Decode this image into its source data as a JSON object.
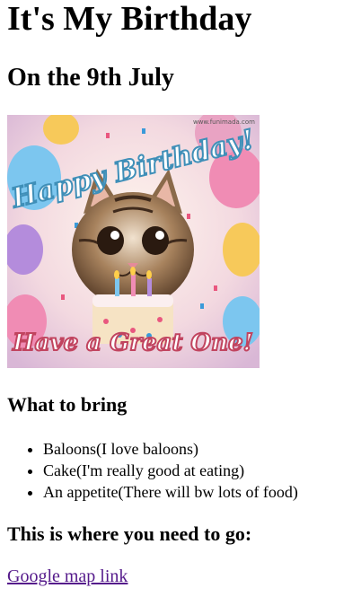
{
  "page": {
    "title": "It's My Birthday",
    "subtitle": "On the 9th July"
  },
  "image": {
    "banner_top": "Happy Birthday!",
    "banner_bottom": "Have a Great One!",
    "watermark": "www.funimada.com",
    "colors": {
      "sky": "#f3d9e0",
      "balloon_pink": "#f08cb4",
      "balloon_blue": "#7cc6ef",
      "balloon_yellow": "#f7c95a",
      "balloon_purple": "#b48cdc",
      "cat_fur": "#8a6a4a",
      "cake": "#f6e3c4"
    }
  },
  "bring": {
    "heading": "What to bring",
    "items": [
      "Baloons(I love baloons)",
      "Cake(I'm really good at eating)",
      "An appetite(There will bw lots of food)"
    ]
  },
  "location": {
    "heading": "This is where you need to go:",
    "link_text": "Google map link"
  }
}
